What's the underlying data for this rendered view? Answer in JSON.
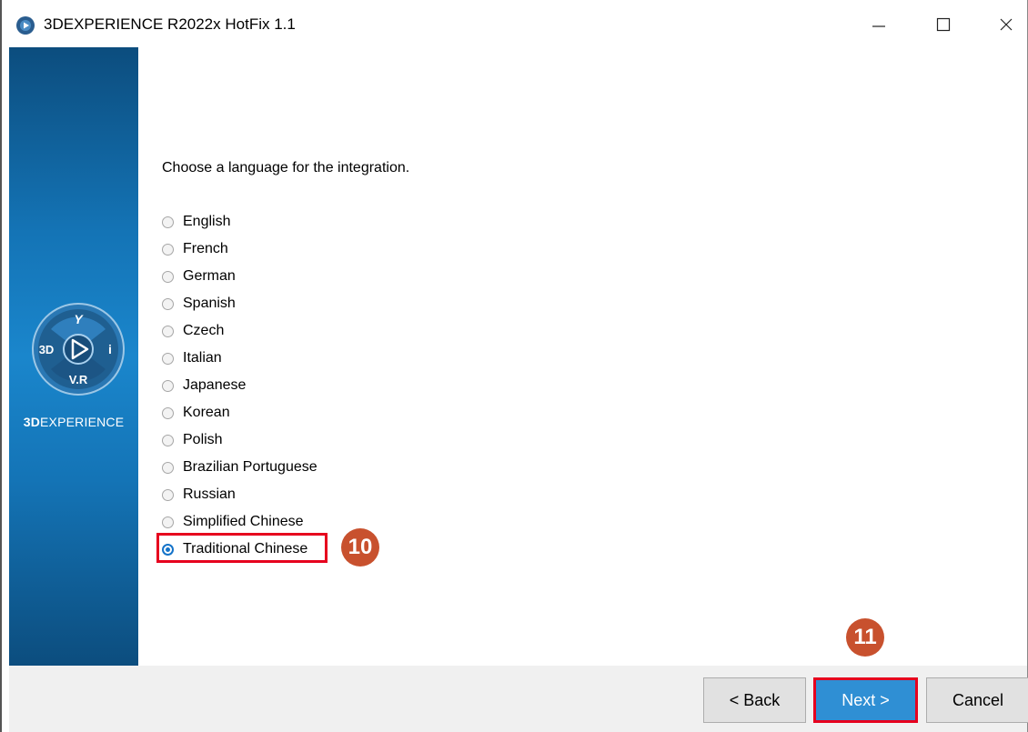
{
  "window": {
    "title": "3DEXPERIENCE R2022x HotFix 1.1",
    "controls": [
      "minimize-icon",
      "maximize-icon",
      "close-icon"
    ]
  },
  "sidebar": {
    "logo_icon": "3dexperience-compass-icon",
    "compass_labels": {
      "top": "Y",
      "left": "3D",
      "right": "i",
      "bottom": "V.R"
    },
    "brand_bold": "3D",
    "brand_rest": "EXPERIENCE"
  },
  "main": {
    "prompt": "Choose a language for the integration.",
    "languages": [
      {
        "label": "English",
        "selected": false
      },
      {
        "label": "French",
        "selected": false
      },
      {
        "label": "German",
        "selected": false
      },
      {
        "label": "Spanish",
        "selected": false
      },
      {
        "label": "Czech",
        "selected": false
      },
      {
        "label": "Italian",
        "selected": false
      },
      {
        "label": "Japanese",
        "selected": false
      },
      {
        "label": "Korean",
        "selected": false
      },
      {
        "label": "Polish",
        "selected": false
      },
      {
        "label": "Brazilian Portuguese",
        "selected": false
      },
      {
        "label": "Russian",
        "selected": false
      },
      {
        "label": "Simplified Chinese",
        "selected": false
      },
      {
        "label": "Traditional Chinese",
        "selected": true
      }
    ]
  },
  "annotations": {
    "step10": "10",
    "step11": "11",
    "highlight_color": "#e6001e",
    "badge_color": "#c8512e"
  },
  "footer": {
    "back_label": "< Back",
    "next_label": "Next >",
    "cancel_label": "Cancel"
  },
  "colors": {
    "sidebar_dark": "#0c4d7e",
    "sidebar_light": "#1a86cc",
    "next_button": "#2f8fd4",
    "radio_selected": "#1473c9"
  }
}
